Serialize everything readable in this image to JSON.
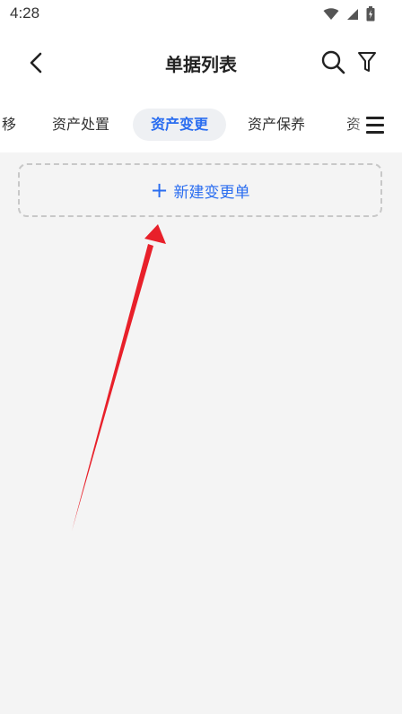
{
  "status_bar": {
    "time": "4:28"
  },
  "header": {
    "title": "单据列表"
  },
  "tabs": [
    {
      "label": "资产处置"
    },
    {
      "label": "资产变更",
      "active": true
    },
    {
      "label": "资产保养"
    }
  ],
  "tab_partial_left": "移",
  "tab_partial_right": "资",
  "new_button": {
    "label": "新建变更单",
    "icon": "plus-icon"
  },
  "accent_color": "#2a6df0",
  "annotation_color": "#e8202a"
}
